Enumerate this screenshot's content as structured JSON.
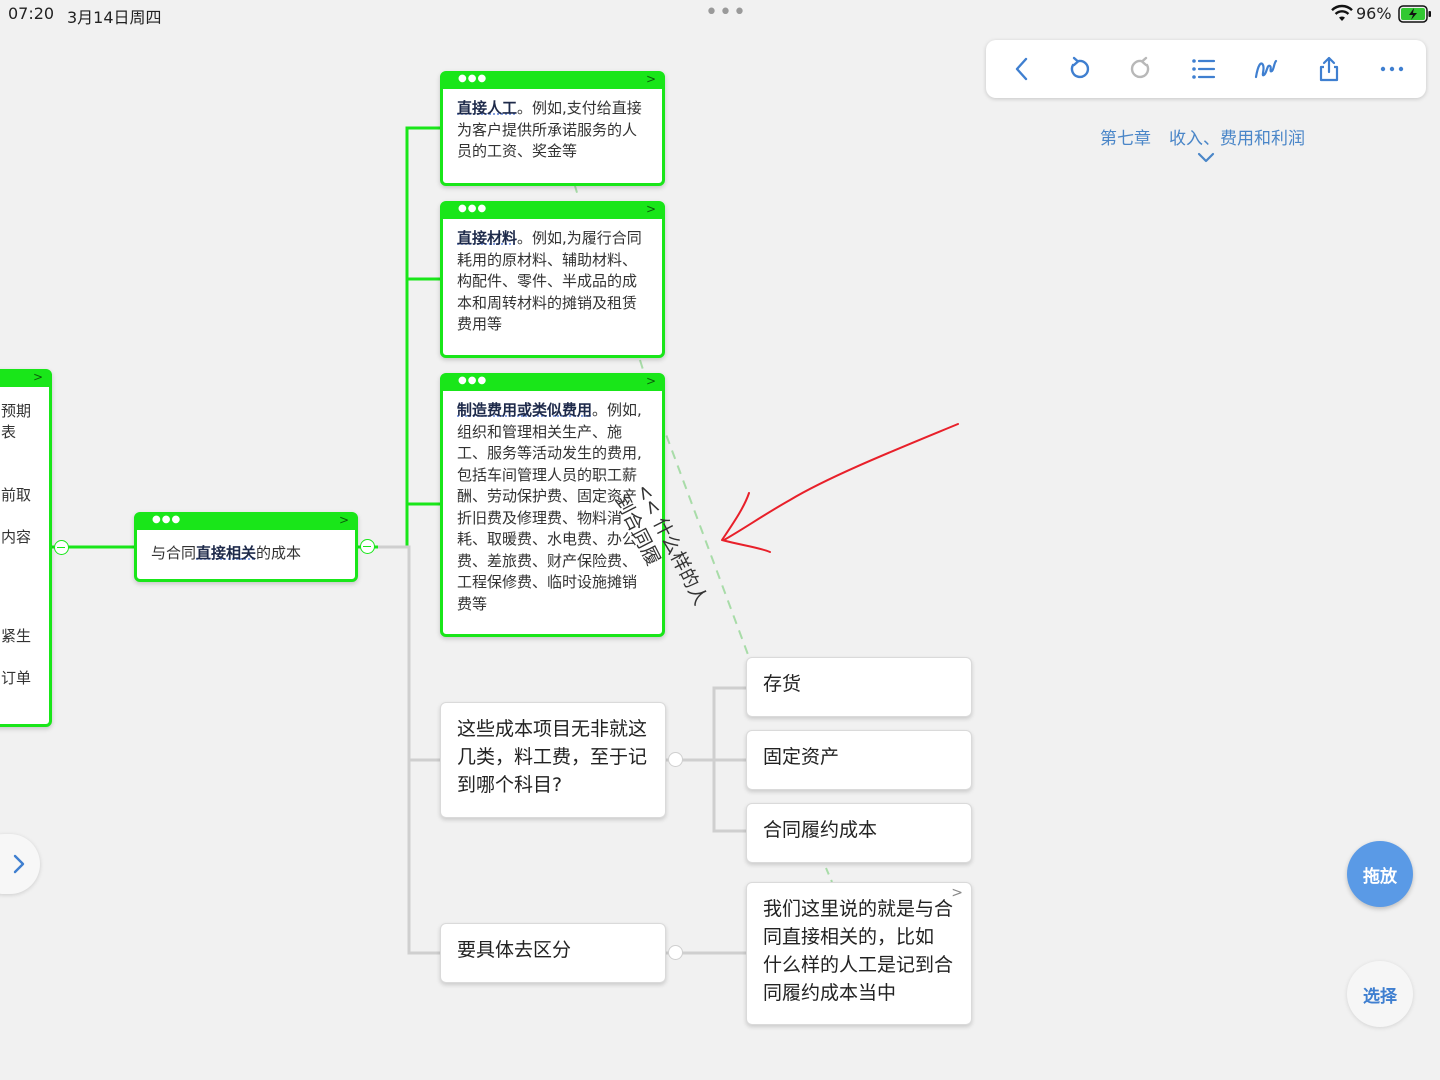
{
  "status_bar": {
    "time": "07:20",
    "date": "3月14日周四",
    "battery": "96%"
  },
  "toolbar": {
    "icons": [
      "back-icon",
      "undo-icon",
      "redo-icon",
      "outline-list-icon",
      "pen-icon",
      "share-icon",
      "more-icon"
    ]
  },
  "breadcrumb": {
    "chapter": "第七章",
    "title": "收入、费用和利润"
  },
  "nodes": {
    "left_partial": {
      "lines": [
        "预期",
        "表",
        "",
        "前取",
        "",
        "内容",
        "",
        "",
        "紧生",
        "",
        "订单"
      ]
    },
    "root": {
      "prefix": "与合同",
      "highlight": "直接相关",
      "suffix": "的成本"
    },
    "labor": {
      "title": "直接人工",
      "text": "。例如,支付给直接为客户提供所承诺服务的人员的工资、奖金等"
    },
    "material": {
      "title": "直接材料",
      "text": "。例如,为履行合同耗用的原材料、辅助材料、构配件、零件、半成品的成本和周转材料的摊销及租赁费用等"
    },
    "overhead": {
      "title": "制造费用或类似费用",
      "text": "。例如,组织和管理相关生产、施工、服务等活动发生的费用,包括车间管理人员的职工薪酬、劳动保护费、固定资产折旧费及修理费、物料消耗、取暖费、水电费、办公费、差旅费、财产保险费、工程保修费、临时设施摊销费等"
    },
    "categories": {
      "text": "这些成本项目无非就这几类，料工费，至于记到哪个科目?"
    },
    "inventory": {
      "text": "存货"
    },
    "fixed_assets": {
      "text": "固定资产"
    },
    "contract_cost": {
      "text": "合同履约成本"
    },
    "distinguish": {
      "text": "要具体去区分"
    },
    "explain": {
      "text": "我们这里说的就是与合同直接相关的，比如 什么样的人工是记到合同履约成本当中"
    }
  },
  "floating_text": {
    "line1": "<< 什么样的人",
    "line2": "到合同履"
  },
  "buttons": {
    "drag": "拖放",
    "select": "选择"
  },
  "colors": {
    "node_border_green": "#19e619",
    "accent_blue": "#4a86c8",
    "drag_button": "#5a9ae6",
    "annotation_red": "#e8202a"
  }
}
